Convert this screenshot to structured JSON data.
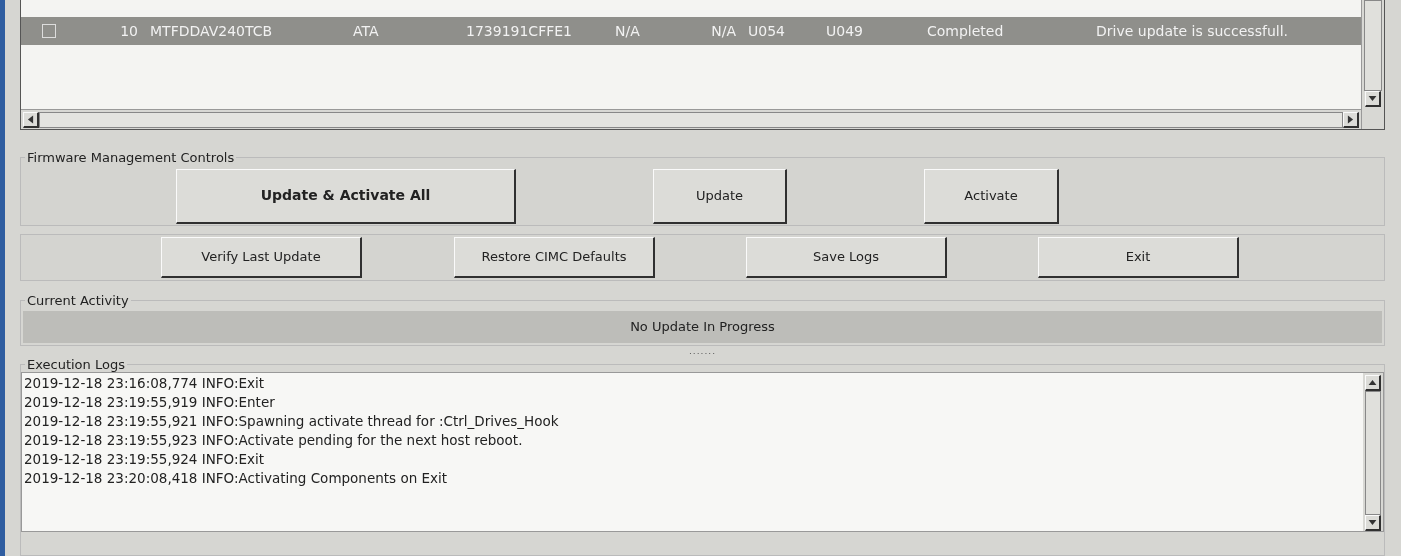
{
  "drive_table": {
    "rows": [
      {
        "selected": true,
        "checked": false,
        "cells": [
          "10",
          "MTFDDAV240TCB",
          "ATA",
          "1739191CFFE1",
          "N/A",
          "N/A",
          "U054",
          "U049",
          "Completed",
          "Drive update is successfull."
        ]
      }
    ]
  },
  "firmware_controls": {
    "title": "Firmware Management Controls",
    "buttons": [
      {
        "label": "Update & Activate All",
        "primary": true
      },
      {
        "label": "Update",
        "primary": false
      },
      {
        "label": "Activate",
        "primary": false
      }
    ]
  },
  "secondary_buttons": [
    "Verify Last Update",
    "Restore CIMC Defaults",
    "Save Logs",
    "Exit"
  ],
  "current_activity": {
    "title": "Current Activity",
    "status": "No Update In Progress"
  },
  "splitter": ".......",
  "execution_logs": {
    "title": "Execution Logs",
    "lines": [
      "2019-12-18 23:16:08,774 INFO:Exit",
      "2019-12-18 23:19:55,919 INFO:Enter",
      "2019-12-18 23:19:55,921 INFO:Spawning activate thread for :Ctrl_Drives_Hook",
      "2019-12-18 23:19:55,923 INFO:Activate pending for the next host reboot.",
      "2019-12-18 23:19:55,924 INFO:Exit",
      "2019-12-18 23:20:08,418 INFO:Activating Components on Exit"
    ]
  }
}
